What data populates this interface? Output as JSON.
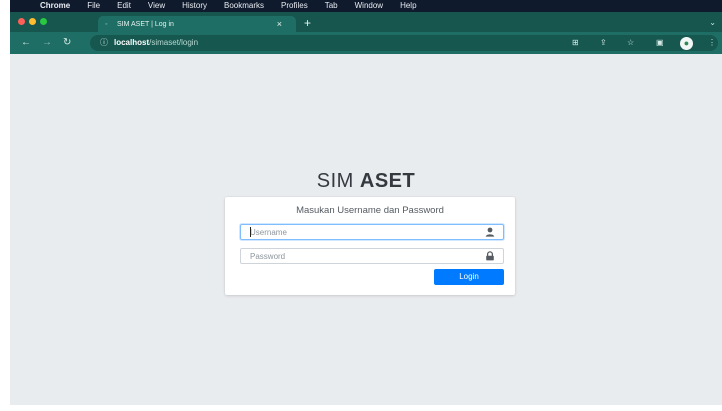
{
  "menubar": {
    "apple_icon": "apple-icon",
    "app": "Chrome",
    "items": [
      "File",
      "Edit",
      "View",
      "History",
      "Bookmarks",
      "Profiles",
      "Tab",
      "Window",
      "Help"
    ]
  },
  "tab": {
    "title": "SIM ASET | Log in",
    "close": "×",
    "new_tab": "+"
  },
  "toolbar": {
    "url_host": "localhost",
    "url_path": "/simaset/login"
  },
  "page": {
    "brand_light": "SIM ",
    "brand_bold": "ASET"
  },
  "login": {
    "message": "Masukan Username dan Password",
    "username_placeholder": "Username",
    "password_placeholder": "Password",
    "button": "Login"
  },
  "colors": {
    "tab_strip": "#17564f",
    "toolbar": "#1f6e65",
    "page_bg": "#e9ecef",
    "button": "#007bff"
  }
}
